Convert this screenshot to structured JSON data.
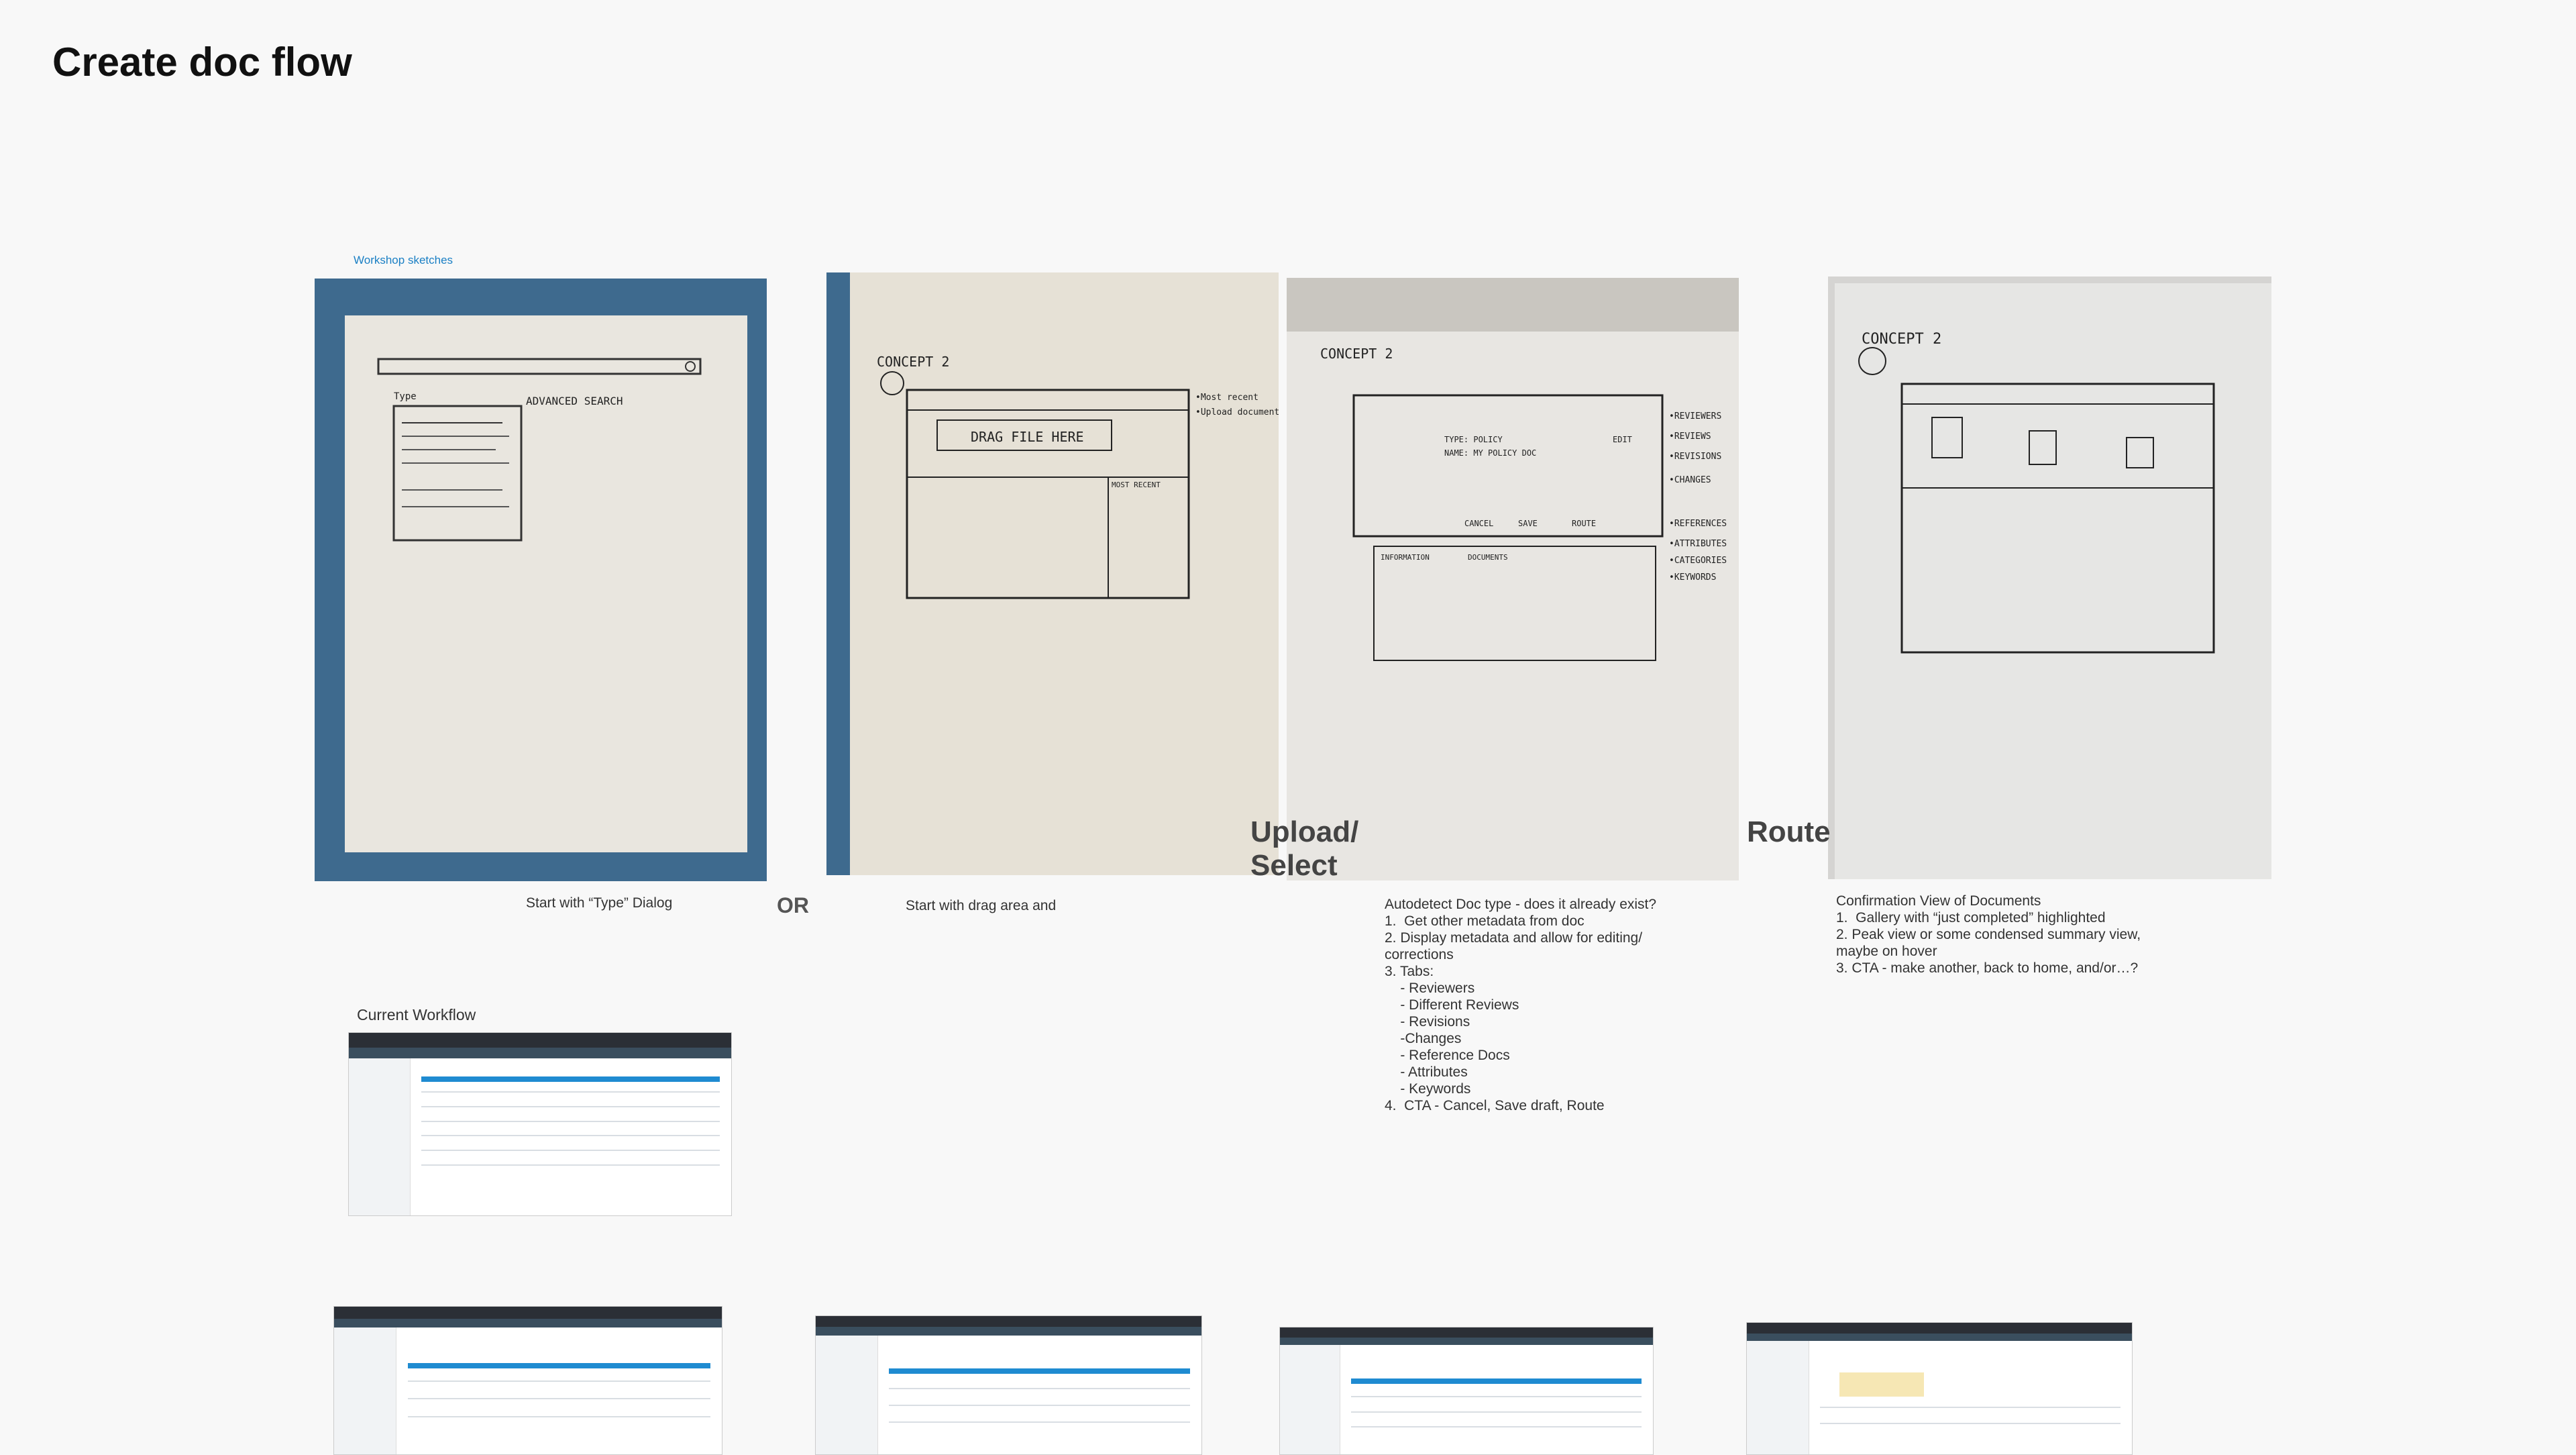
{
  "page": {
    "title": "Create doc flow",
    "workshop_link": "Workshop sketches",
    "current_workflow_label": "Current Workflow"
  },
  "sketches": [
    {
      "caption": "Start with “Type” Dialog",
      "heading": "",
      "sketch_text": [
        "ADVANCED SEARCH",
        "Type"
      ]
    },
    {
      "caption": "Start with drag area and",
      "heading": "",
      "sketch_text": [
        "CONCEPT 2",
        "DRAG FILE HERE",
        "•Most recent",
        "•Upload document",
        "MOST RECENT"
      ]
    },
    {
      "caption": "",
      "heading": "Upload/\nSelect",
      "sketch_text": [
        "CONCEPT 2",
        "TYPE: POLICY",
        "NAME: MY POLICY DOC",
        "EDIT",
        "CANCEL",
        "SAVE",
        "ROUTE",
        "INFORMATION",
        "DOCUMENTS",
        "•REVIEWERS",
        "•REVIEWS",
        "•REVISIONS",
        "•CHANGES",
        "•REFERENCES",
        "•ATTRIBUTES",
        "•CATEGORIES",
        "•KEYWORDS"
      ]
    },
    {
      "caption": "",
      "heading": "Route",
      "sketch_text": [
        "CONCEPT 2"
      ]
    }
  ],
  "connector": "OR",
  "notes": {
    "concept2": "Autodetect Doc type - does it already exist?\n1.  Get other metadata from doc\n2. Display metadata and allow for editing/\ncorrections\n3. Tabs:\n    - Reviewers\n    - Different Reviews\n    - Revisions\n    -Changes\n    - Reference Docs\n    - Attributes\n    - Keywords\n4.  CTA - Cancel, Save draft, Route",
    "concept3": "Confirmation View of Documents\n1.  Gallery with “just completed” highlighted\n2. Peak view or some condensed summary view,\nmaybe on hover\n3. CTA - make another, back to home, and/or…?"
  },
  "colors": {
    "background": "#f8f8f8",
    "paper": "#e9e6df",
    "board_blue": "#3e6a8e",
    "link": "#1a7fc4"
  }
}
